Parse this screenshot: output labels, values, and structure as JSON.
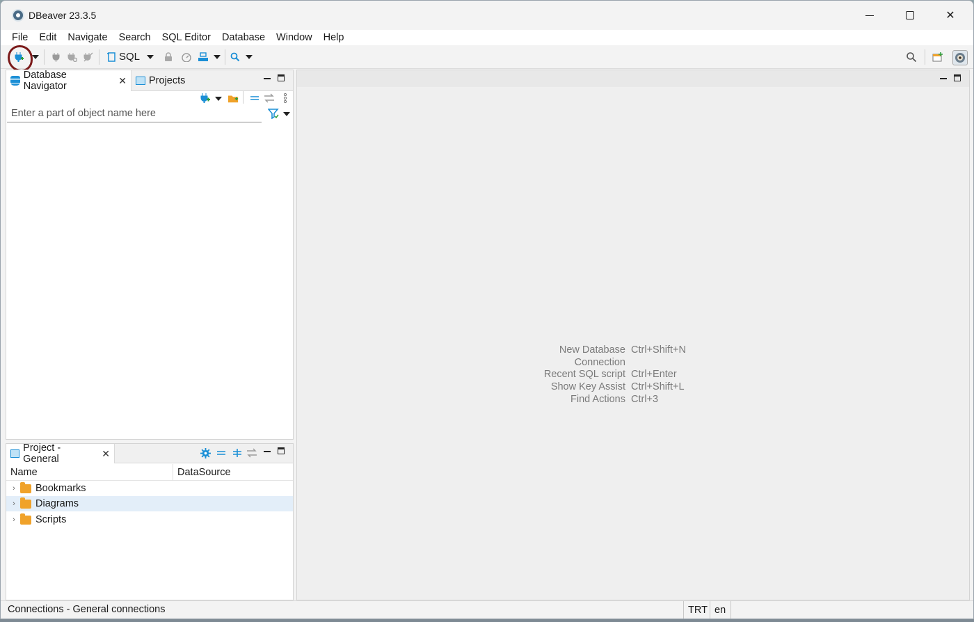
{
  "window": {
    "title": "DBeaver 23.3.5"
  },
  "menu": [
    "File",
    "Edit",
    "Navigate",
    "Search",
    "SQL Editor",
    "Database",
    "Window",
    "Help"
  ],
  "toolbar": {
    "sql_label": "SQL"
  },
  "navigator": {
    "tab_label": "Database Navigator",
    "projects_tab_label": "Projects",
    "search_placeholder": "Enter a part of object name here"
  },
  "project_panel": {
    "tab_label": "Project - General",
    "columns": [
      "Name",
      "DataSource"
    ],
    "items": [
      {
        "label": "Bookmarks",
        "selected": false
      },
      {
        "label": "Diagrams",
        "selected": true
      },
      {
        "label": "Scripts",
        "selected": false
      }
    ]
  },
  "editor_hints": [
    {
      "label": "New Database Connection",
      "shortcut": "Ctrl+Shift+N"
    },
    {
      "label": "Recent SQL script",
      "shortcut": "Ctrl+Enter"
    },
    {
      "label": "Show Key Assist",
      "shortcut": "Ctrl+Shift+L"
    },
    {
      "label": "Find Actions",
      "shortcut": "Ctrl+3"
    }
  ],
  "status": {
    "text": "Connections - General connections",
    "timezone": "TRT",
    "locale": "en"
  },
  "colors": {
    "accent": "#1b8fd6",
    "annotation": "#7b1a1a",
    "folder": "#f0a22a"
  }
}
